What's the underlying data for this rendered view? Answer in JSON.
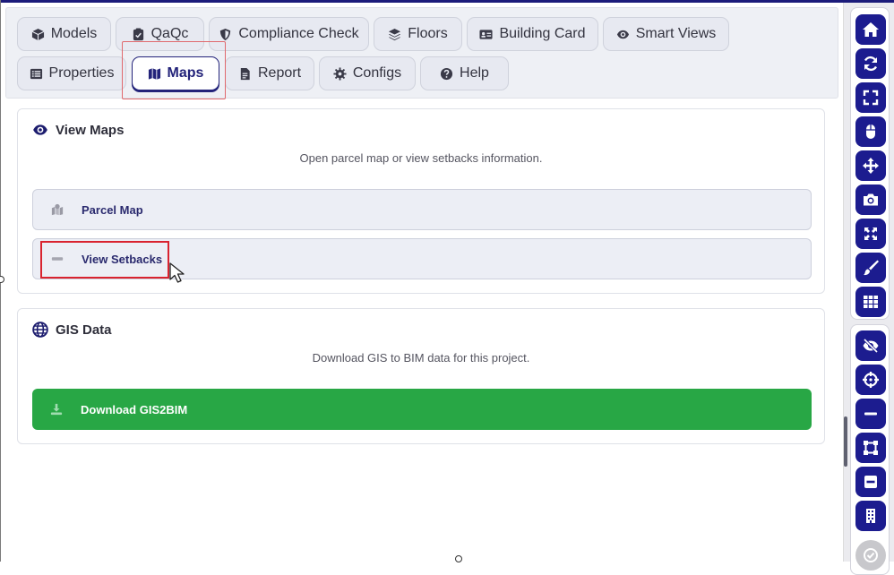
{
  "tabs": {
    "row1": [
      {
        "label": "Models",
        "icon": "cube-icon"
      },
      {
        "label": "QaQc",
        "icon": "clipboard-check-icon"
      },
      {
        "label": "Compliance Check",
        "icon": "shield-icon"
      },
      {
        "label": "Floors",
        "icon": "layers-icon"
      },
      {
        "label": "Building Card",
        "icon": "id-card-icon"
      },
      {
        "label": "Smart Views",
        "icon": "eye-icon"
      }
    ],
    "row2": [
      {
        "label": "Properties",
        "icon": "list-icon"
      },
      {
        "label": "Maps",
        "icon": "map-icon",
        "active": true
      },
      {
        "label": "Report",
        "icon": "document-icon"
      },
      {
        "label": "Configs",
        "icon": "gear-icon"
      },
      {
        "label": "Help",
        "icon": "question-icon"
      }
    ]
  },
  "view_maps": {
    "title": "View Maps",
    "description": "Open parcel map or view setbacks information.",
    "parcel_map_label": "Parcel Map",
    "view_setbacks_label": "View Setbacks"
  },
  "gis_data": {
    "title": "GIS Data",
    "description": "Download GIS to BIM data for this project.",
    "download_label": "Download GIS2BIM"
  },
  "toolbar": {
    "group1": [
      "home-icon",
      "refresh-icon",
      "fullscreen-icon",
      "mouse-icon",
      "move-icon",
      "camera-icon",
      "expand-icon",
      "brush-icon",
      "grid-icon"
    ],
    "group2": [
      "eye-slash-icon",
      "crosshair-icon",
      "minus-icon",
      "section-box-icon",
      "collapse-icon",
      "building-icon",
      "check-circle-icon"
    ]
  },
  "colors": {
    "accent": "#1c1c8f",
    "success": "#28a745",
    "highlight": "#d9232f"
  }
}
